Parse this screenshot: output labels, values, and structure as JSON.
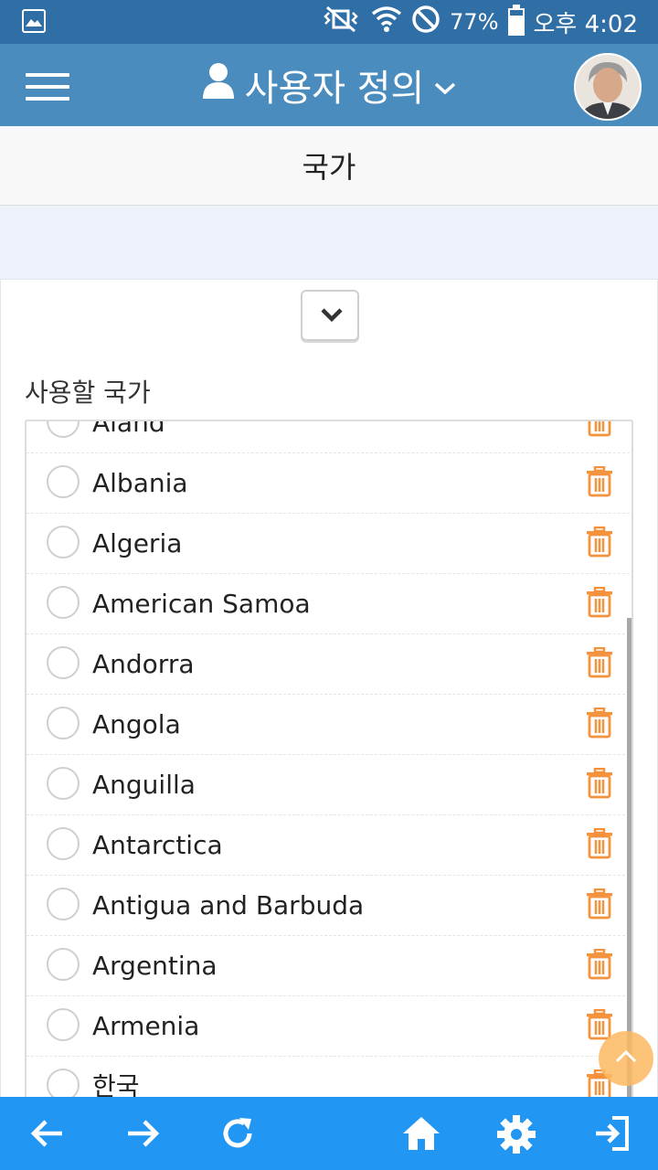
{
  "status_bar": {
    "battery_percent": "77%",
    "battery_level": 0.77,
    "time": "오후 4:02",
    "icons": [
      "gallery-icon",
      "vibrate-mute-icon",
      "wifi-icon",
      "do-not-disturb-icon",
      "battery-icon"
    ]
  },
  "header": {
    "title": "사용자 정의",
    "icons": [
      "menu-icon",
      "user-icon",
      "chevron-down-icon",
      "avatar"
    ]
  },
  "subheader": {
    "title": "국가"
  },
  "section": {
    "label": "사용할 국가"
  },
  "countries": [
    {
      "name": "Aland"
    },
    {
      "name": "Albania"
    },
    {
      "name": "Algeria"
    },
    {
      "name": "American Samoa"
    },
    {
      "name": "Andorra"
    },
    {
      "name": "Angola"
    },
    {
      "name": "Anguilla"
    },
    {
      "name": "Antarctica"
    },
    {
      "name": "Antigua and Barbuda"
    },
    {
      "name": "Argentina"
    },
    {
      "name": "Armenia"
    },
    {
      "name": "한국"
    }
  ],
  "colors": {
    "status_bar": "#2f6fa6",
    "header": "#4a8cbd",
    "bottom_nav": "#2196f3",
    "trash": "#f5923e",
    "scroll_top": "#fcb862"
  },
  "bottom_nav": {
    "icons": [
      "back-arrow-icon",
      "forward-arrow-icon",
      "refresh-icon",
      "home-icon",
      "gear-icon",
      "logout-icon"
    ]
  }
}
